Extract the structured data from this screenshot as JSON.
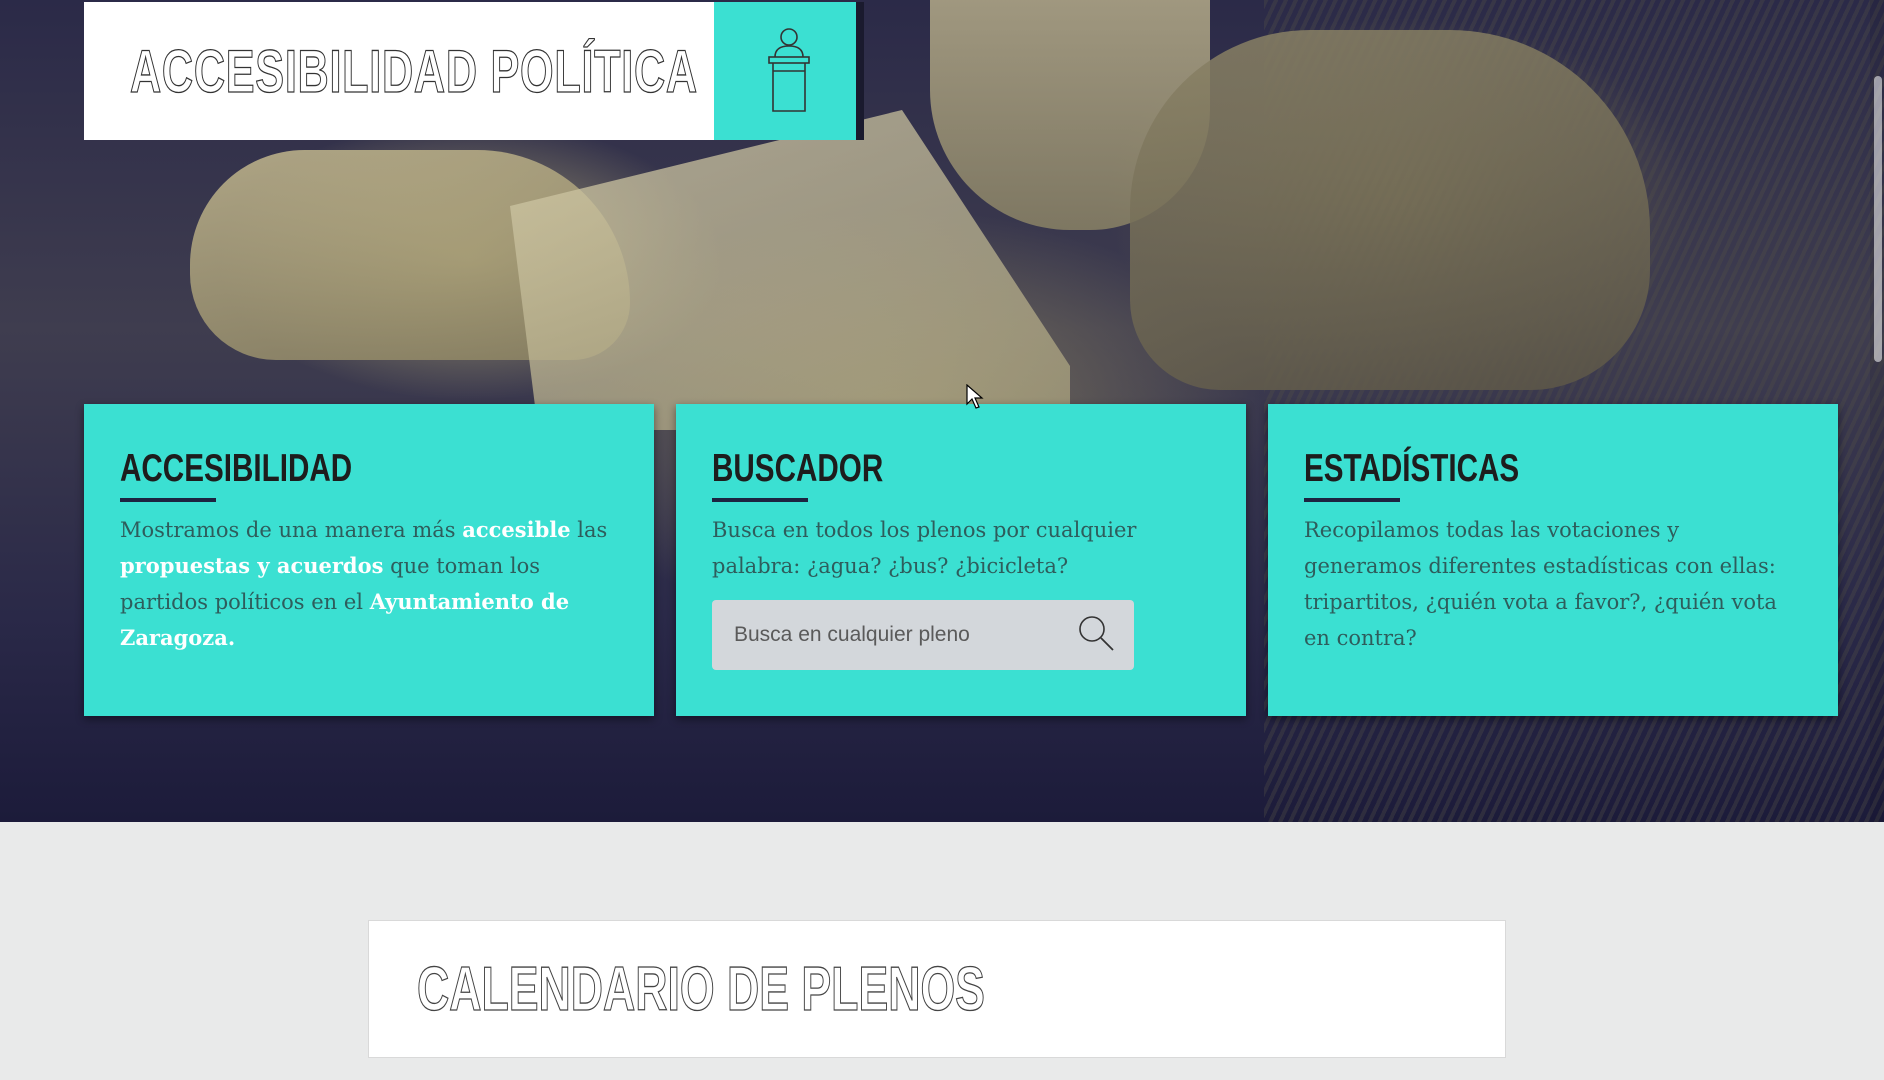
{
  "header": {
    "title": "ACCESIBILIDAD POLÍTICA",
    "logo_icon": "podium-speaker-icon",
    "accent_color": "#3be0d2"
  },
  "cards": [
    {
      "title": "ACCESIBILIDAD",
      "text_parts": [
        {
          "text": "Mostramos de una manera más ",
          "bold": false
        },
        {
          "text": "accesible",
          "bold": true
        },
        {
          "text": " las ",
          "bold": false
        },
        {
          "text": "propuestas y acuerdos",
          "bold": true
        },
        {
          "text": " que toman los partidos políticos en el ",
          "bold": false
        },
        {
          "text": "Ayuntamiento de Zaragoza.",
          "bold": true
        }
      ]
    },
    {
      "title": "BUSCADOR",
      "text": "Busca en todos los plenos por cualquier palabra: ¿agua? ¿bus? ¿bicicleta?",
      "search": {
        "placeholder": "Busca en cualquier pleno",
        "value": "",
        "icon": "search-icon"
      }
    },
    {
      "title": "ESTADÍSTICAS",
      "text": "Recopilamos todas las votaciones y generamos diferentes estadísticas con ellas: tripartitos, ¿quién vota a favor?, ¿quién vota en contra?"
    }
  ],
  "calendar": {
    "title": "CALENDARIO DE PLENOS"
  }
}
